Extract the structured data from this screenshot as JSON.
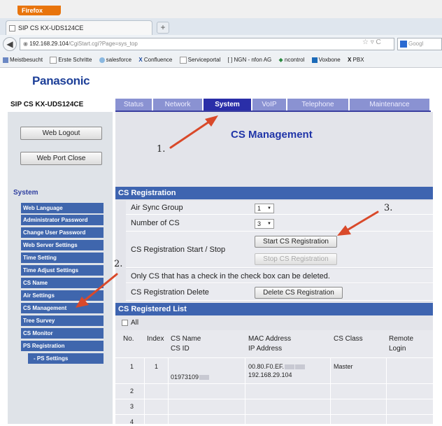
{
  "browser": {
    "app_button": "Firefox",
    "tab_title": "SIP CS KX-UDS124CE",
    "url": "192.168.29.104",
    "url_path": "/CgiStart.cgi?Page=sys_top",
    "search_placeholder": "Googl",
    "bookmarks": [
      "Meistbesucht",
      "Erste Schritte",
      "salesforce",
      "Confluence",
      "Serviceportal",
      "NGN - nfon AG",
      "ncontrol",
      "Voxbone",
      "PBX"
    ]
  },
  "header": {
    "logo": "Panasonic",
    "model": "SIP CS KX-UDS124CE"
  },
  "nav_tabs": [
    "Status",
    "Network",
    "System",
    "VoIP",
    "Telephone",
    "Maintenance"
  ],
  "sidebar": {
    "logout": "Web Logout",
    "port_close": "Web Port Close",
    "heading": "System",
    "items": [
      "Web Language",
      "Administrator Password",
      "Change User Password",
      "Web Server Settings",
      "Time Setting",
      "Time Adjust Settings",
      "CS Name",
      "Air Settings",
      "CS Management",
      "Tree Survey",
      "CS Monitor",
      "PS Registration"
    ],
    "subitem": "- PS Settings"
  },
  "main": {
    "title": "CS Management",
    "registration": {
      "heading": "CS Registration",
      "air_sync_label": "Air Sync Group",
      "air_sync_value": "1",
      "num_cs_label": "Number of CS",
      "num_cs_value": "3",
      "start_stop_label": "CS Registration Start / Stop",
      "start_btn": "Start CS Registration",
      "stop_btn": "Stop CS Registration",
      "note": "Only CS that has a check in the check box can be deleted.",
      "delete_label": "CS Registration Delete",
      "delete_btn": "Delete CS Registration"
    },
    "registered": {
      "heading": "CS Registered List",
      "all_label": "All",
      "columns": {
        "no": "No.",
        "index": "Index",
        "cs_name": "CS Name",
        "cs_id": "CS ID",
        "mac": "MAC Address",
        "ip": "IP Address",
        "cs_class": "CS Class",
        "remote": "Remote",
        "login": "Login"
      },
      "row1": {
        "no": "1",
        "index": "1",
        "cs_id": "01973109",
        "mac": "00.80.F0.EF.",
        "ip": "192.168.29.104",
        "cs_class": "Master"
      },
      "row_numbers": [
        "2",
        "3",
        "4"
      ]
    }
  },
  "annotations": [
    "1.",
    "2.",
    "3."
  ],
  "colors": {
    "nav_active": "#2a2ea8",
    "sidebar_item": "#3f66ad",
    "section_header": "#3e64b0",
    "arrow": "#d9492a",
    "logo": "#1d3f98"
  }
}
